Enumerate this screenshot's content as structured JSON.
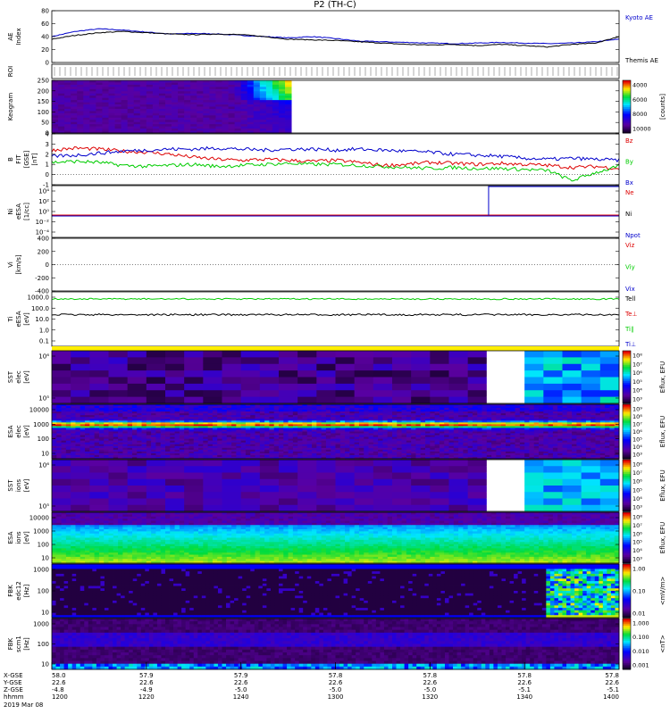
{
  "title": "P2 (TH-C)",
  "colors": {
    "blue": "#0000cc",
    "red": "#dd0000",
    "green": "#00cc00",
    "black": "#000000",
    "yellow": "#ffee00",
    "cyan": "#00ffff",
    "navy": "#000080",
    "purple": "#5000a0"
  },
  "time_axis": {
    "ticks": [
      "1200",
      "1220",
      "1240",
      "1300",
      "1320",
      "1340",
      "1400"
    ],
    "rows": [
      {
        "label": "X-GSE",
        "values": [
          "58.0",
          "57.9",
          "57.9",
          "57.8",
          "57.8",
          "57.8",
          "57.8"
        ]
      },
      {
        "label": "Y-GSE",
        "values": [
          "22.6",
          "22.6",
          "22.6",
          "22.6",
          "22.6",
          "22.6",
          "22.6"
        ]
      },
      {
        "label": "Z-GSE",
        "values": [
          "-4.8",
          "-4.9",
          "-5.0",
          "-5.0",
          "-5.0",
          "-5.1",
          "-5.1"
        ]
      },
      {
        "label": "hhmm",
        "values": [
          "1200",
          "1220",
          "1240",
          "1300",
          "1320",
          "1340",
          "1400"
        ]
      }
    ],
    "date": "2019 Mar 08"
  },
  "chart_data": [
    {
      "id": "ae",
      "type": "line",
      "ylabel": "AE Index",
      "ylim": [
        0,
        80
      ],
      "ticks": [
        "0",
        "20",
        "40",
        "60",
        "80"
      ],
      "legend": [
        "Kyoto AE",
        "Themis AE"
      ],
      "series": [
        {
          "name": "Kyoto AE",
          "color": "blue",
          "values": [
            40,
            48,
            52,
            50,
            47,
            44,
            45,
            44,
            42,
            40,
            38,
            40,
            37,
            33,
            32,
            31,
            30,
            29,
            30,
            31,
            30,
            29,
            30,
            32,
            36
          ]
        },
        {
          "name": "Themis AE",
          "color": "black",
          "values": [
            36,
            42,
            46,
            48,
            46,
            44,
            43,
            44,
            43,
            40,
            36,
            35,
            34,
            32,
            30,
            28,
            27,
            28,
            26,
            28,
            26,
            24,
            28,
            30,
            40
          ]
        }
      ]
    },
    {
      "id": "roi",
      "type": "strip",
      "ylabel": "ROI"
    },
    {
      "id": "keogram",
      "type": "heatmap",
      "ylabel": "Keogram",
      "ylim": [
        0,
        250
      ],
      "ticks": [
        "0",
        "50",
        "100",
        "150",
        "200",
        "250"
      ],
      "colorbar": {
        "ticks": [
          "4000",
          "6000",
          "8000",
          "10000"
        ],
        "label": "[counts]"
      },
      "data_end_fraction": 0.42
    },
    {
      "id": "bfield",
      "type": "line",
      "ylabel": "B FIT [GSE] [nT]",
      "ylim": [
        -1,
        4
      ],
      "ticks": [
        "-1",
        "0",
        "1",
        "2",
        "3",
        "4"
      ],
      "legend": [
        "Bz",
        "By",
        "Bx"
      ],
      "series": [
        {
          "name": "Bz",
          "color": "red",
          "values": [
            2.4,
            2.6,
            2.5,
            2.3,
            2.2,
            2.0,
            1.7,
            1.5,
            1.4,
            1.5,
            1.4,
            1.3,
            1.4,
            1.2,
            0.9,
            1.0,
            1.2,
            1.1,
            1.0,
            1.1,
            1.0,
            0.9,
            0.7,
            0.8,
            0.6
          ]
        },
        {
          "name": "By",
          "color": "green",
          "values": [
            1.2,
            1.3,
            1.2,
            0.9,
            0.8,
            0.9,
            1.0,
            0.8,
            0.9,
            1.0,
            1.1,
            1.0,
            1.0,
            0.9,
            0.8,
            0.7,
            0.6,
            0.7,
            0.6,
            0.6,
            0.5,
            0.4,
            -0.6,
            0.2,
            0.8
          ]
        },
        {
          "name": "Bx",
          "color": "blue",
          "values": [
            1.8,
            1.9,
            2.1,
            2.3,
            2.4,
            2.5,
            2.5,
            2.6,
            2.5,
            2.4,
            2.5,
            2.5,
            2.4,
            2.5,
            2.4,
            2.3,
            2.2,
            2.0,
            1.9,
            1.8,
            1.6,
            1.5,
            1.6,
            1.5,
            1.4
          ]
        }
      ]
    },
    {
      "id": "density",
      "type": "line",
      "ylabel": "Ni eESA [1/cc]",
      "ticks": [
        "10⁴",
        "10²",
        "10⁰",
        "10⁻²",
        "10⁻⁴"
      ],
      "legend": [
        "Ne",
        "Ni",
        "Npot"
      ]
    },
    {
      "id": "velocity",
      "type": "line",
      "ylabel": "Vi [km/s]",
      "ylim": [
        -400,
        400
      ],
      "ticks": [
        "-400",
        "-200",
        "0",
        "200",
        "400"
      ],
      "legend": [
        "Viz",
        "Viy",
        "Vix"
      ]
    },
    {
      "id": "temperature",
      "type": "line",
      "ylabel": "Ti eESA [eV]",
      "ticks": [
        "1000.0",
        "100.0",
        "10.0",
        "1.0",
        "0.1"
      ],
      "legend": [
        "Tell",
        "Te⊥",
        "Ti∥",
        "Ti⊥"
      ]
    },
    {
      "id": "sst_e",
      "type": "heatmap",
      "ylabel": "SST elec [eV]",
      "ticks": [
        "10⁶",
        "10⁵"
      ],
      "colorbar": {
        "ticks": [
          "10⁸",
          "10⁷",
          "10⁶",
          "10⁵",
          "10⁴",
          "10³"
        ],
        "label": "Eflux, EFU"
      }
    },
    {
      "id": "esa_e",
      "type": "heatmap",
      "ylabel": "ESA elec [eV]",
      "ticks": [
        "10000",
        "1000",
        "100",
        "10"
      ],
      "colorbar": {
        "ticks": [
          "10⁹",
          "10⁸",
          "10⁷",
          "10⁶",
          "10⁵",
          "10⁴",
          "10³"
        ],
        "label": "Eflux, EFU"
      }
    },
    {
      "id": "sst_i",
      "type": "heatmap",
      "ylabel": "SST ions [eV]",
      "ticks": [
        "10⁶",
        "10⁵"
      ],
      "colorbar": {
        "ticks": [
          "10⁸",
          "10⁷",
          "10⁶",
          "10⁵",
          "10⁴",
          "10³"
        ],
        "label": "Eflux, EFU"
      }
    },
    {
      "id": "esa_i",
      "type": "heatmap",
      "ylabel": "ESA ions [eV]",
      "ticks": [
        "10000",
        "1000",
        "100",
        "10"
      ],
      "colorbar": {
        "ticks": [
          "10⁸",
          "10⁷",
          "10⁶",
          "10⁵",
          "10⁴",
          "10³"
        ],
        "label": "Eflux, EFU"
      }
    },
    {
      "id": "fbk_e",
      "type": "heatmap",
      "ylabel": "FBK edc12 [Hz]",
      "ticks": [
        "1000",
        "100",
        "10"
      ],
      "colorbar": {
        "ticks": [
          "1.00",
          "0.10",
          "0.01"
        ],
        "label": "<mV/m>"
      }
    },
    {
      "id": "fbk_b",
      "type": "heatmap",
      "ylabel": "FBK scm1 [Hz]",
      "ticks": [
        "1000",
        "100",
        "10"
      ],
      "colorbar": {
        "ticks": [
          "1.000",
          "0.100",
          "0.010",
          "0.001"
        ],
        "label": "<nT>"
      }
    }
  ]
}
